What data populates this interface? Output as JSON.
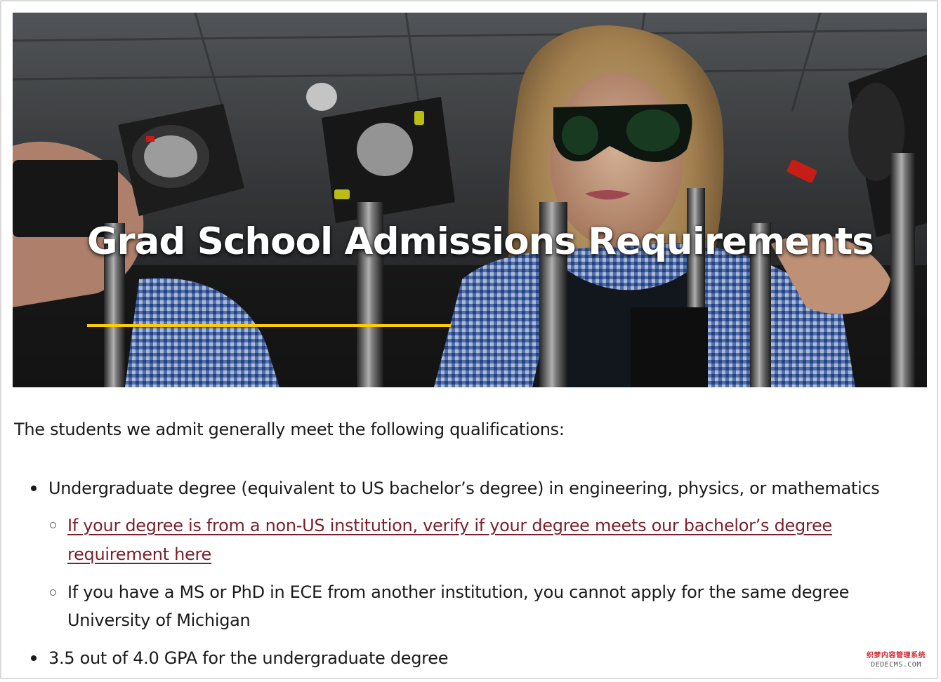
{
  "hero": {
    "title": "Grad School Admissions Requirements",
    "accent_color": "#ffcb05",
    "image_alt": "student wearing laser safety goggles working with optical equipment"
  },
  "content": {
    "intro": "The students we admit generally meet the following qualifications:",
    "requirements": [
      {
        "text": "Undergraduate degree (equivalent to US bachelor’s degree)  in engineering, physics, or mathematics",
        "sub": [
          {
            "type": "link",
            "line1": "If your degree is from a non-US institution, verify if your degree meets our bachelor’s degree",
            "line2": "requirement here",
            "color": "#7a1f2b"
          },
          {
            "type": "text",
            "line1": "If you have a MS or PhD in ECE from another institution, you cannot apply for the same degree",
            "line2": "University of Michigan"
          }
        ]
      },
      {
        "text": "3.5 out of 4.0 GPA for the undergraduate degree"
      }
    ]
  },
  "watermark": {
    "cn": "织梦内容管理系统",
    "en": "DEDECMS.COM"
  }
}
